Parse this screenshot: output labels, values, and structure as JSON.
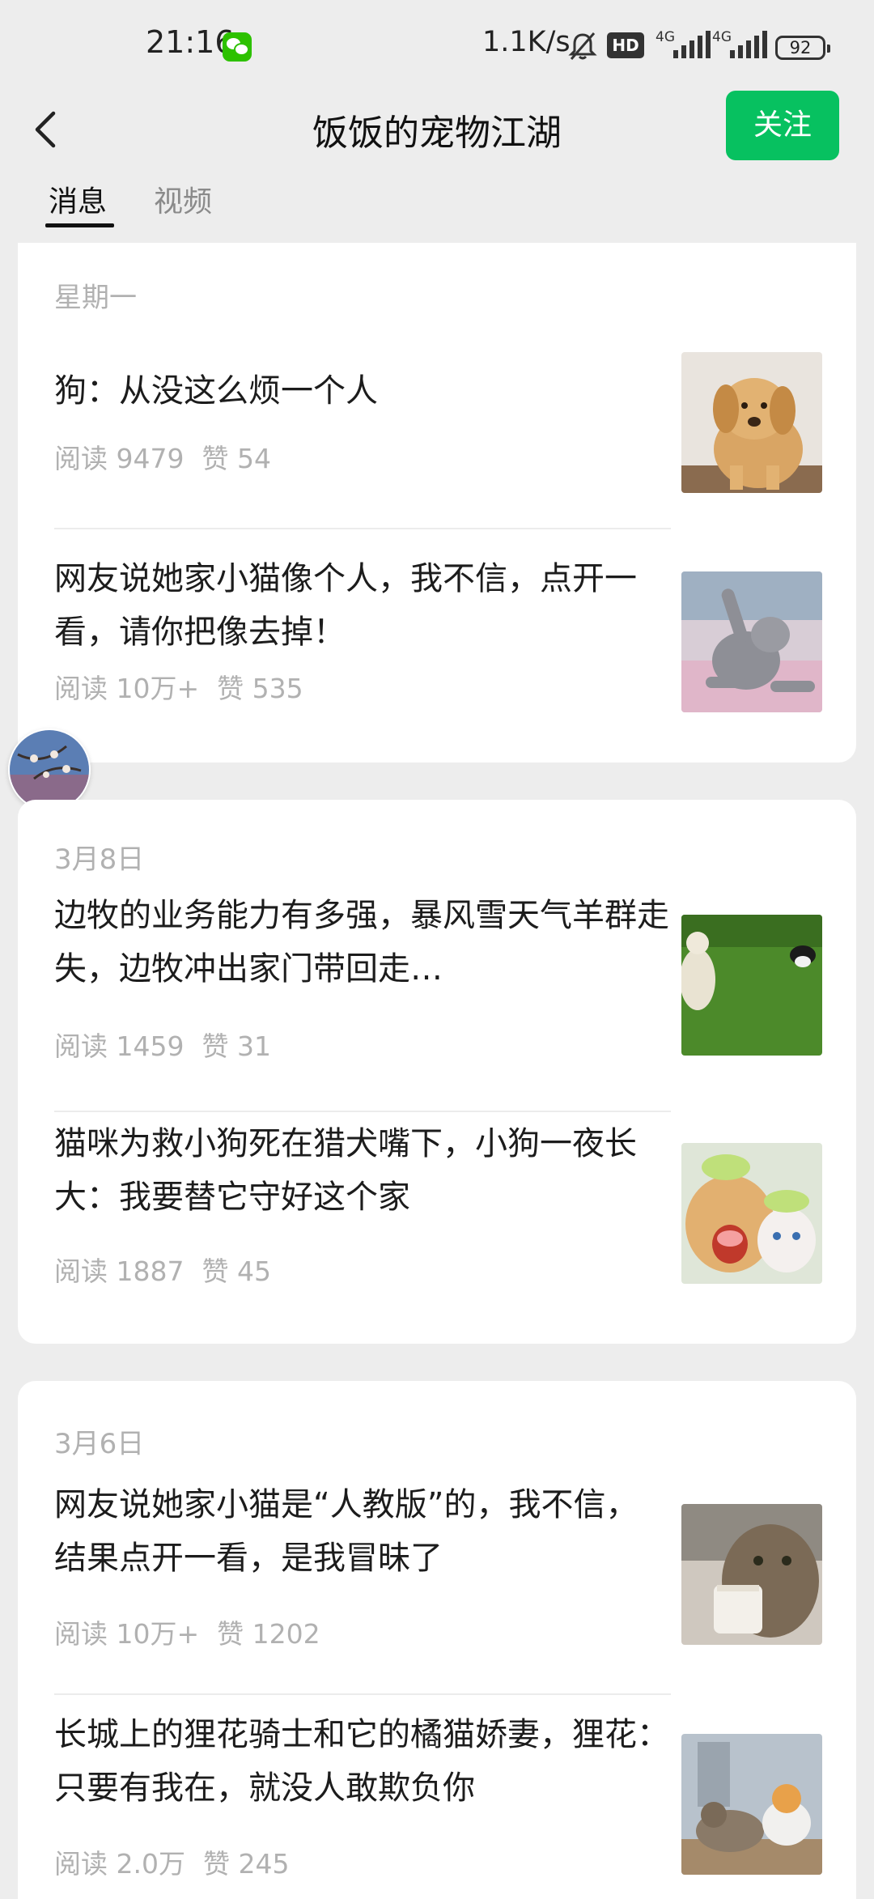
{
  "status_bar": {
    "time": "21:16",
    "app_icon": "wechat-notification-icon",
    "net_speed": "1.1K/s",
    "hd_badge": "HD",
    "signal1_label": "4G",
    "signal2_label": "4G",
    "battery": "92"
  },
  "nav": {
    "title": "饭饭的宠物江湖",
    "follow_label": "关注",
    "back_icon": "chevron-left-icon"
  },
  "tabs": [
    {
      "label": "消息",
      "active": true
    },
    {
      "label": "视频",
      "active": false
    }
  ],
  "groups": [
    {
      "date": "星期一",
      "items": [
        {
          "title": "狗：从没这么烦一个人",
          "reads": "阅读 9479",
          "likes": "赞 54",
          "thumb": "golden-retriever-puppy"
        },
        {
          "title": "网友说她家小猫像个人，我不信，点开一看，请你把像去掉！",
          "reads": "阅读 10万+",
          "likes": "赞 535",
          "thumb": "grey-cat-sitting"
        }
      ]
    },
    {
      "date": "3月8日",
      "items": [
        {
          "title": "边牧的业务能力有多强，暴风雪天气羊群走失，边牧冲出家门带回走…",
          "reads": "阅读 1459",
          "likes": "赞 31",
          "thumb": "border-collie-and-sheep"
        },
        {
          "title": "猫咪为救小狗死在猎犬嘴下，小狗一夜长大：我要替它守好这个家",
          "reads": "阅读 1887",
          "likes": "赞 45",
          "thumb": "dog-and-kitten-with-hats"
        }
      ]
    },
    {
      "date": "3月6日",
      "items": [
        {
          "title": "网友说她家小猫是“人教版”的，我不信，结果点开一看，是我冒昧了",
          "reads": "阅读 10万+",
          "likes": "赞 1202",
          "thumb": "tabby-cat-drinking"
        },
        {
          "title": "长城上的狸花骑士和它的橘猫娇妻，狸花：只要有我在，就没人敢欺负你",
          "reads": "阅读 2.0万",
          "likes": "赞 245",
          "thumb": "cats-on-great-wall"
        }
      ]
    }
  ],
  "floating_avatar": "profile-avatar"
}
